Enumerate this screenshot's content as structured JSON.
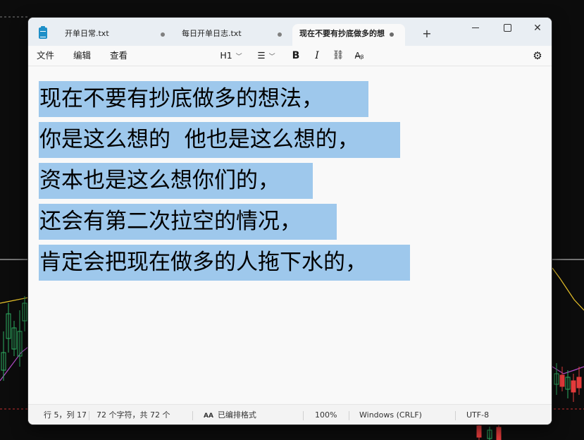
{
  "tabs": [
    {
      "label": "开单日常.txt",
      "active": false
    },
    {
      "label": "每日开单日志.txt",
      "active": false
    },
    {
      "label": "现在不要有抄底做多的想",
      "active": true
    }
  ],
  "menu": {
    "file": "文件",
    "edit": "编辑",
    "view": "查看"
  },
  "toolbar": {
    "heading": "H1"
  },
  "editor": {
    "lines": [
      "现在不要有抄底做多的想法，",
      "你是这么想的  他也是这么想的，",
      "资本也是这么想你们的，",
      "还会有第二次拉空的情况，",
      "肯定会把现在做多的人拖下水的，"
    ]
  },
  "status": {
    "position": "行 5，列 17",
    "char_count": "72 个字符，共 72 个",
    "format": "已编排格式",
    "zoom": "100%",
    "line_ending": "Windows (CRLF)",
    "encoding": "UTF-8"
  },
  "colors": {
    "selection": "#9ec8ec",
    "candle_up": "#2eae62",
    "candle_down": "#e33b3b",
    "indicator_line": "#e8c22a"
  }
}
